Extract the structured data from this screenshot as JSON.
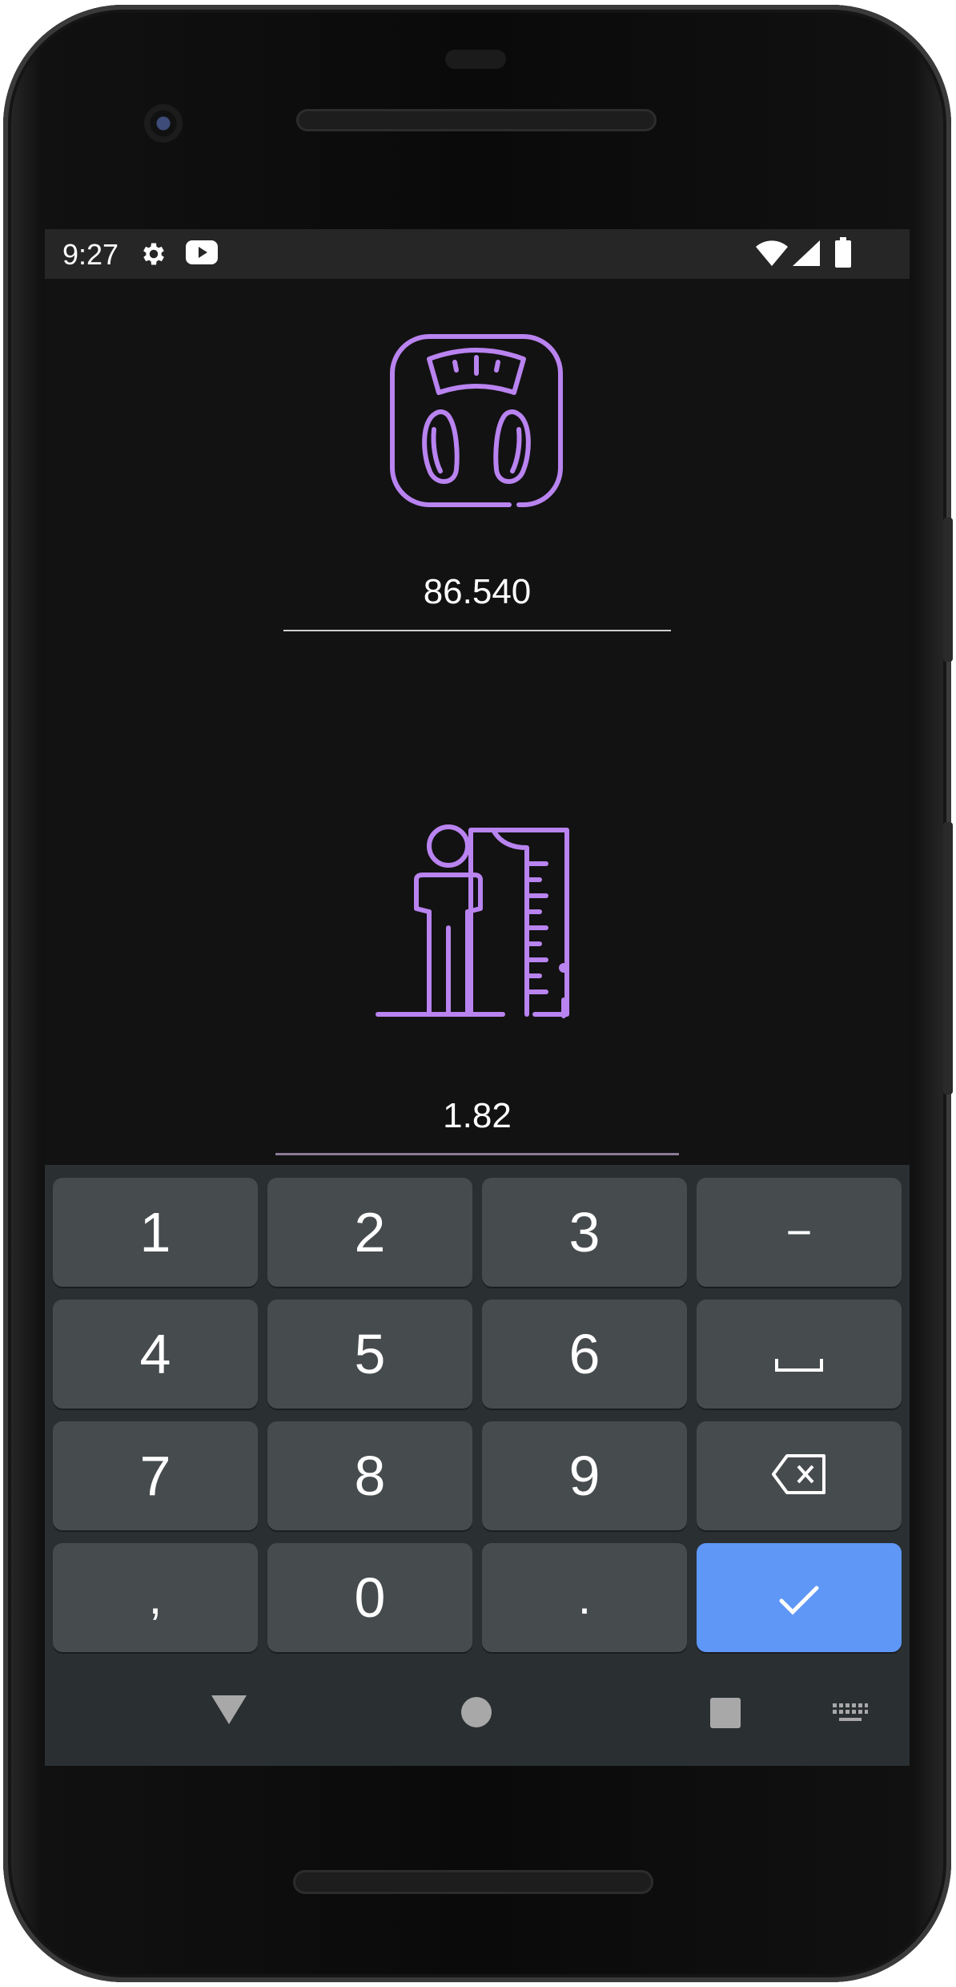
{
  "status_bar": {
    "time": "9:27",
    "left_icons": [
      "gear-icon",
      "youtube-icon"
    ],
    "right_icons": [
      "wifi-icon",
      "signal-icon",
      "battery-icon"
    ]
  },
  "weight": {
    "icon": "scale-icon",
    "value": "86.540"
  },
  "height": {
    "icon": "height-measure-icon",
    "value": "1.82"
  },
  "keyboard": {
    "keys": [
      "1",
      "2",
      "3",
      "−",
      "4",
      "5",
      "6",
      "␣",
      "7",
      "8",
      "9",
      "⌫",
      ",",
      "0",
      ".",
      "✓"
    ],
    "action_color": "#5e97f6"
  },
  "nav_bar": {
    "icons": [
      "back-icon",
      "home-icon",
      "recents-icon",
      "keyboard-switch-icon"
    ]
  },
  "colors": {
    "accent": "#b983f0",
    "screen_bg": "#121212",
    "keyboard_bg": "#2a2f32",
    "key_bg": "#464b4e"
  }
}
